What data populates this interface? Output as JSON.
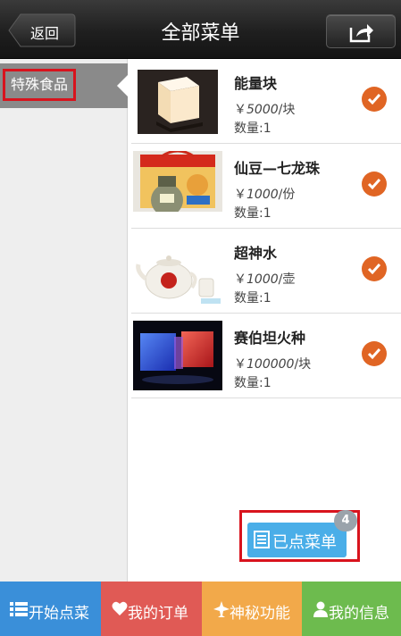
{
  "header": {
    "back_label": "返回",
    "title": "全部菜单"
  },
  "sidebar": {
    "items": [
      {
        "label": "特殊食品"
      }
    ]
  },
  "menu": {
    "items": [
      {
        "name": "能量块",
        "price": "5000",
        "unit": "/块",
        "qty_label": "数量:1"
      },
      {
        "name": "仙豆—七龙珠",
        "price": "1000",
        "unit": "/份",
        "qty_label": "数量:1"
      },
      {
        "name": "超神水",
        "price": "1000",
        "unit": "/壶",
        "qty_label": "数量:1"
      },
      {
        "name": "赛伯坦火种",
        "price": "100000",
        "unit": "/块",
        "qty_label": "数量:1"
      }
    ],
    "currency": "￥"
  },
  "ordered": {
    "label": "已点菜单",
    "count": "4"
  },
  "tabbar": {
    "tabs": [
      {
        "label": "开始点菜",
        "icon": "list-icon",
        "color": "#3a8fd9"
      },
      {
        "label": "我的订单",
        "icon": "heart-icon",
        "color": "#e05a55"
      },
      {
        "label": "神秘功能",
        "icon": "plane-icon",
        "color": "#f2a94a"
      },
      {
        "label": "我的信息",
        "icon": "person-icon",
        "color": "#6dbb4e"
      }
    ]
  },
  "colors": {
    "check": "#e06524",
    "highlight": "#d8131d",
    "ordered_button": "#4aaee8"
  }
}
